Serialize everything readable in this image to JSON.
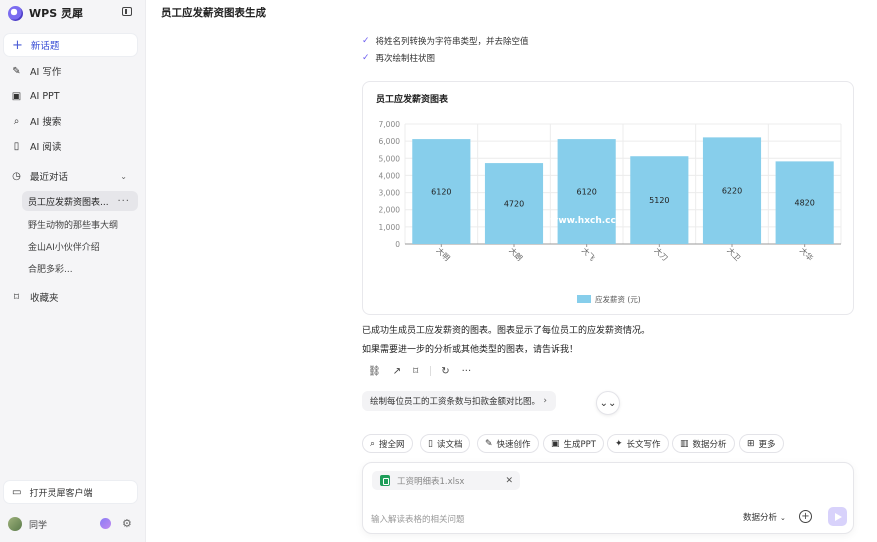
{
  "sidebar": {
    "brand": "WPS 灵犀",
    "new_chat": "新话题",
    "nav": [
      {
        "label": "AI 写作",
        "icon": "pen-icon"
      },
      {
        "label": "AI PPT",
        "icon": "ppt-icon"
      },
      {
        "label": "AI 搜索",
        "icon": "search-icon"
      },
      {
        "label": "AI 阅读",
        "icon": "book-icon"
      },
      {
        "label": "最近对话",
        "icon": "clock-icon"
      }
    ],
    "recent": [
      "员工应发薪资图表...",
      "野生动物的那些事大纲",
      "金山AI小伙伴介绍",
      "合肥多彩..."
    ],
    "favorites": "收藏夹",
    "open_client": "打开灵犀客户端",
    "user_name": "同学"
  },
  "main": {
    "title": "员工应发薪资图表生成",
    "checklist": [
      "将姓名列转换为字符串类型，并去除空值",
      "再次绘制柱状图"
    ],
    "summary": [
      "已成功生成员工应发薪资的图表。图表显示了每位员工的应发薪资情况。",
      "如果需要进一步的分析或其他类型的图表，请告诉我！"
    ],
    "suggestion": "绘制每位员工的工资条数与扣款金额对比图。",
    "tools": [
      "搜全网",
      "读文档",
      "快速创作",
      "生成PPT",
      "长文写作",
      "数据分析",
      "更多"
    ]
  },
  "input": {
    "file_name": "工资明细表1.xlsx",
    "placeholder": "输入解读表格的相关问题",
    "mode": "数据分析"
  },
  "watermark": "www.hxch.cc",
  "chart_data": {
    "type": "bar",
    "title": "员工应发薪资图表",
    "categories": [
      "大明",
      "大朗",
      "大飞",
      "大刀",
      "大卫",
      "大华"
    ],
    "series": [
      {
        "name": "应发薪资 (元)",
        "values": [
          6120,
          4720,
          6120,
          5120,
          6220,
          4820
        ]
      }
    ],
    "ylim": [
      0,
      7000
    ],
    "yticks": [
      "0",
      "1,000",
      "2,000",
      "3,000",
      "4,000",
      "5,000",
      "6,000",
      "7,000"
    ],
    "grid": true,
    "legend": "bottom-center",
    "bar_color": "#87ceeb"
  }
}
